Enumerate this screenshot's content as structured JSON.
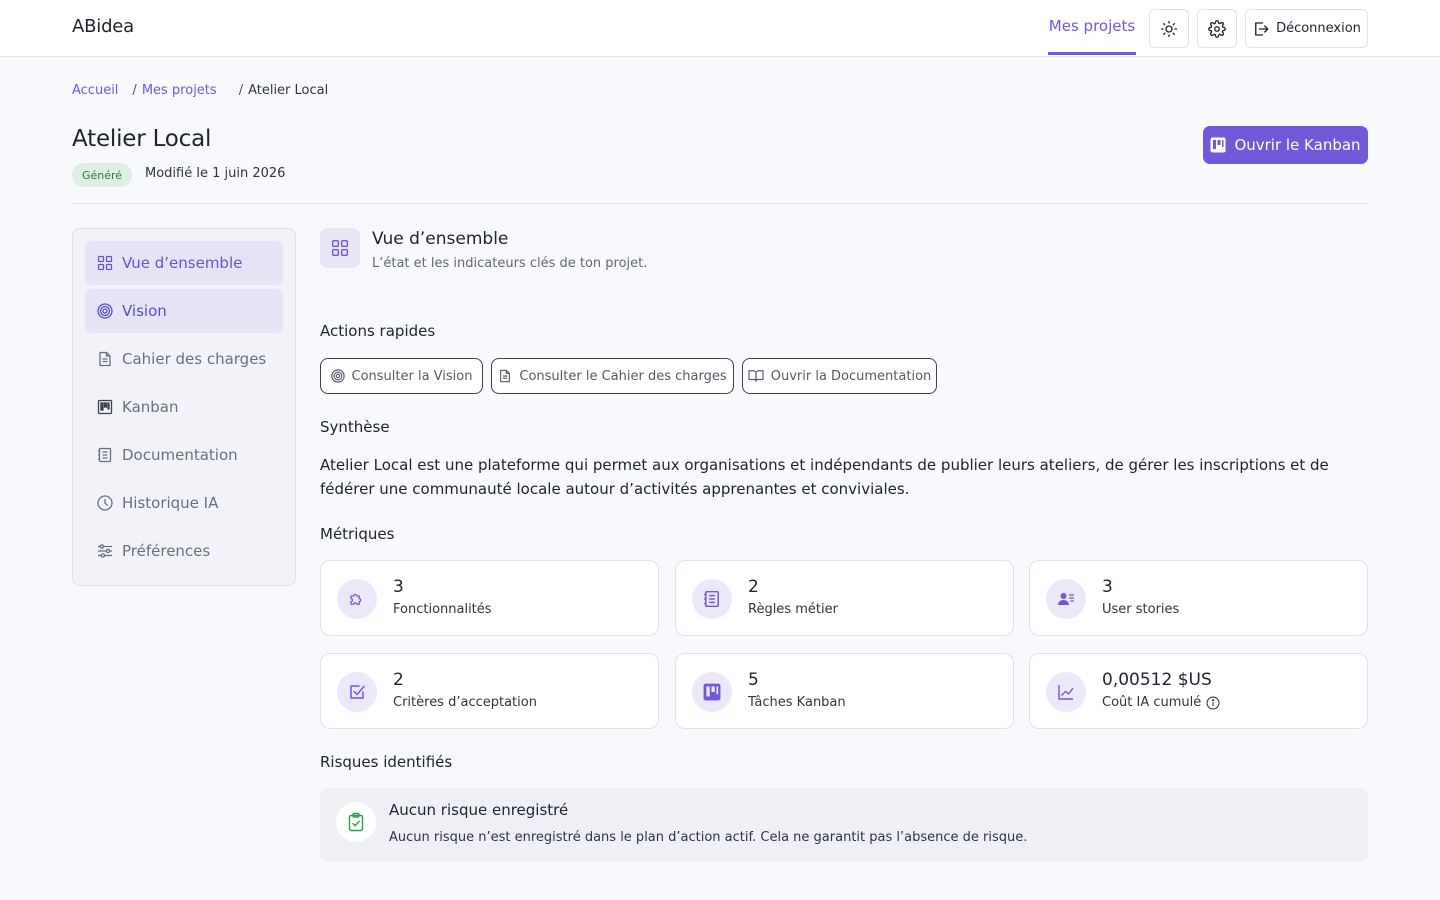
{
  "header": {
    "brand": "ABidea",
    "nav_link": "Mes projets",
    "logout_label": "Déconnexion"
  },
  "breadcrumb": {
    "home": "Accueil",
    "projects": "Mes projets",
    "current": "Atelier Local",
    "separator": "/"
  },
  "project": {
    "title": "Atelier Local",
    "status": "Généré",
    "modified": "Modifié le 1 juin 2026",
    "open_kanban": "Ouvrir le Kanban"
  },
  "sidebar": {
    "items": [
      {
        "label": "Vue d’ensemble",
        "icon": "grid-icon"
      },
      {
        "label": "Vision",
        "icon": "target-icon"
      },
      {
        "label": "Cahier des charges",
        "icon": "document-icon"
      },
      {
        "label": "Kanban",
        "icon": "kanban-icon"
      },
      {
        "label": "Documentation",
        "icon": "notebook-icon"
      },
      {
        "label": "Historique IA",
        "icon": "clock-icon"
      },
      {
        "label": "Préférences",
        "icon": "sliders-icon"
      }
    ]
  },
  "overview": {
    "title": "Vue d’ensemble",
    "subtitle": "L’état et les indicateurs clés de ton projet.",
    "quick_actions_label": "Actions rapides",
    "actions": [
      {
        "label": "Consulter la Vision"
      },
      {
        "label": "Consulter le Cahier des charges"
      },
      {
        "label": "Ouvrir la Documentation"
      }
    ],
    "summary_label": "Synthèse",
    "summary": "Atelier Local est une plateforme qui permet aux organisations et indépendants de publier leurs ateliers, de gérer les inscriptions et de fédérer une communauté locale autour d’activités apprenantes et conviviales.",
    "metrics_label": "Métriques",
    "metrics": [
      {
        "value": "3",
        "label": "Fonctionnalités",
        "icon": "puzzle-icon"
      },
      {
        "value": "2",
        "label": "Règles métier",
        "icon": "rules-icon"
      },
      {
        "value": "3",
        "label": "User stories",
        "icon": "users-icon"
      },
      {
        "value": "2",
        "label": "Critères d’acceptation",
        "icon": "checkbox-icon"
      },
      {
        "value": "5",
        "label": "Tâches Kanban",
        "icon": "kanban-icon"
      },
      {
        "value": "0,00512 $US",
        "label": "Coût IA cumulé",
        "icon": "chart-line-icon"
      }
    ],
    "risks_label": "Risques identifiés",
    "risk_empty_title": "Aucun risque enregistré",
    "risk_empty_text": "Aucun risque n’est enregistré dans le plan d’action actif. Cela ne garantit pas l’absence de risque."
  },
  "colors": {
    "accent": "#7357d9",
    "success_bg": "#dcefe2",
    "success_text": "#2d7a44"
  }
}
